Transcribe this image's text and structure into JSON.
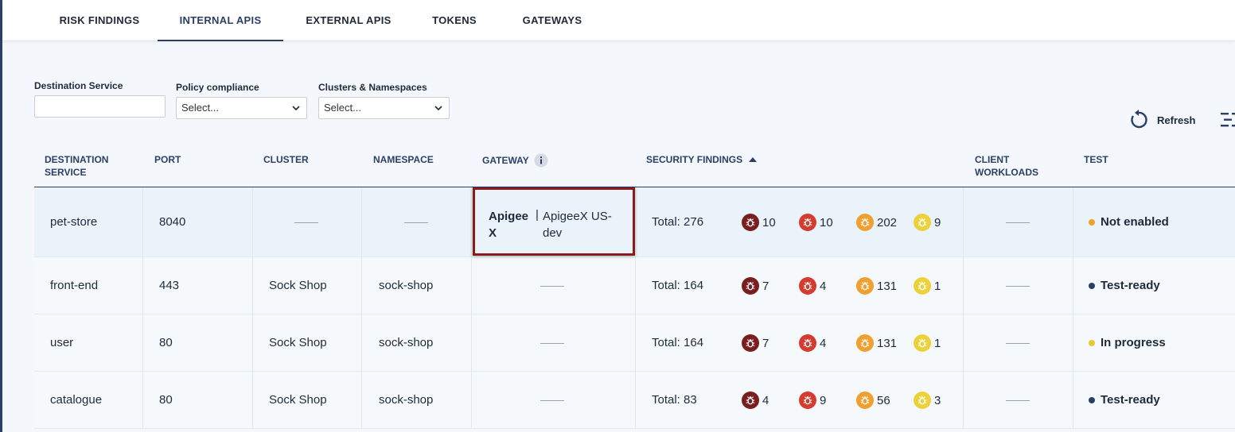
{
  "tabs": [
    {
      "label": "RISK FINDINGS",
      "active": false
    },
    {
      "label": "INTERNAL APIS",
      "active": true
    },
    {
      "label": "EXTERNAL APIS",
      "active": false
    },
    {
      "label": "TOKENS",
      "active": false
    },
    {
      "label": "GATEWAYS",
      "active": false
    }
  ],
  "filters": {
    "destination_service": {
      "label": "Destination Service",
      "value": ""
    },
    "policy_compliance": {
      "label": "Policy compliance",
      "value": "Select..."
    },
    "clusters_namespaces": {
      "label": "Clusters & Namespaces",
      "value": "Select..."
    }
  },
  "toolbar": {
    "refresh_label": "Refresh"
  },
  "table": {
    "headers": {
      "destination_service": "DESTINATION SERVICE",
      "port": "PORT",
      "cluster": "CLUSTER",
      "namespace": "NAMESPACE",
      "gateway": "GATEWAY",
      "security_findings": "SECURITY FINDINGS",
      "client_workloads": "CLIENT WORKLOADS",
      "test": "TEST"
    },
    "rows": [
      {
        "destination_service": "pet-store",
        "port": "8040",
        "cluster": "",
        "namespace": "",
        "gateway_name": "Apigee X",
        "gateway_sep": "|",
        "gateway_desc": "ApigeeX US-dev",
        "total": "Total: 276",
        "critical": "10",
        "high": "10",
        "medium": "202",
        "low": "9",
        "test": "Not enabled",
        "test_color": "#f0a030"
      },
      {
        "destination_service": "front-end",
        "port": "443",
        "cluster": "Sock Shop",
        "namespace": "sock-shop",
        "total": "Total: 164",
        "critical": "7",
        "high": "4",
        "medium": "131",
        "low": "1",
        "test": "Test-ready",
        "test_color": "#2b3f66"
      },
      {
        "destination_service": "user",
        "port": "80",
        "cluster": "Sock Shop",
        "namespace": "sock-shop",
        "total": "Total: 164",
        "critical": "7",
        "high": "4",
        "medium": "131",
        "low": "1",
        "test": "In progress",
        "test_color": "#e8c830"
      },
      {
        "destination_service": "catalogue",
        "port": "80",
        "cluster": "Sock Shop",
        "namespace": "sock-shop",
        "total": "Total: 83",
        "critical": "4",
        "high": "9",
        "medium": "56",
        "low": "3",
        "test": "Test-ready",
        "test_color": "#2b3f66"
      }
    ]
  },
  "severity_colors": {
    "critical": "#7a1f1f",
    "high": "#d63b2f",
    "medium": "#f0a030",
    "low": "#ecd23a"
  }
}
